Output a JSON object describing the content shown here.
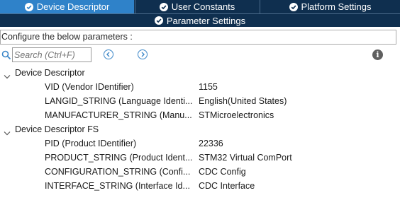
{
  "tabs": [
    {
      "label": "Device Descriptor",
      "active": true
    },
    {
      "label": "User Constants",
      "active": false
    },
    {
      "label": "Platform Settings",
      "active": false
    },
    {
      "label": "Parameter Settings",
      "active": false
    }
  ],
  "configure_label": "Configure the below parameters :",
  "search": {
    "placeholder": "Search (Ctrl+F)"
  },
  "icons": {
    "search": "search-icon",
    "prev": "chevron-left-icon",
    "next": "chevron-right-icon",
    "info": "info-icon",
    "tab_check": "check-circle-icon"
  },
  "colors": {
    "tab_active": "#2f82c9",
    "tab_inactive": "#0f2f4f",
    "check": "#ffffff",
    "accent": "#3b86c8"
  },
  "groups": [
    {
      "label": "Device Descriptor",
      "params": [
        {
          "name": "VID (Vendor IDentifier)",
          "value": "1155"
        },
        {
          "name": "LANGID_STRING (Language Identi...",
          "value": "English(United States)"
        },
        {
          "name": "MANUFACTURER_STRING (Manu...",
          "value": "STMicroelectronics"
        }
      ]
    },
    {
      "label": "Device Descriptor FS",
      "params": [
        {
          "name": "PID (Product IDentifier)",
          "value": "22336"
        },
        {
          "name": "PRODUCT_STRING (Product Ident...",
          "value": "STM32 Virtual ComPort"
        },
        {
          "name": "CONFIGURATION_STRING (Confi...",
          "value": "CDC Config"
        },
        {
          "name": "INTERFACE_STRING (Interface Id...",
          "value": "CDC Interface"
        }
      ]
    }
  ]
}
